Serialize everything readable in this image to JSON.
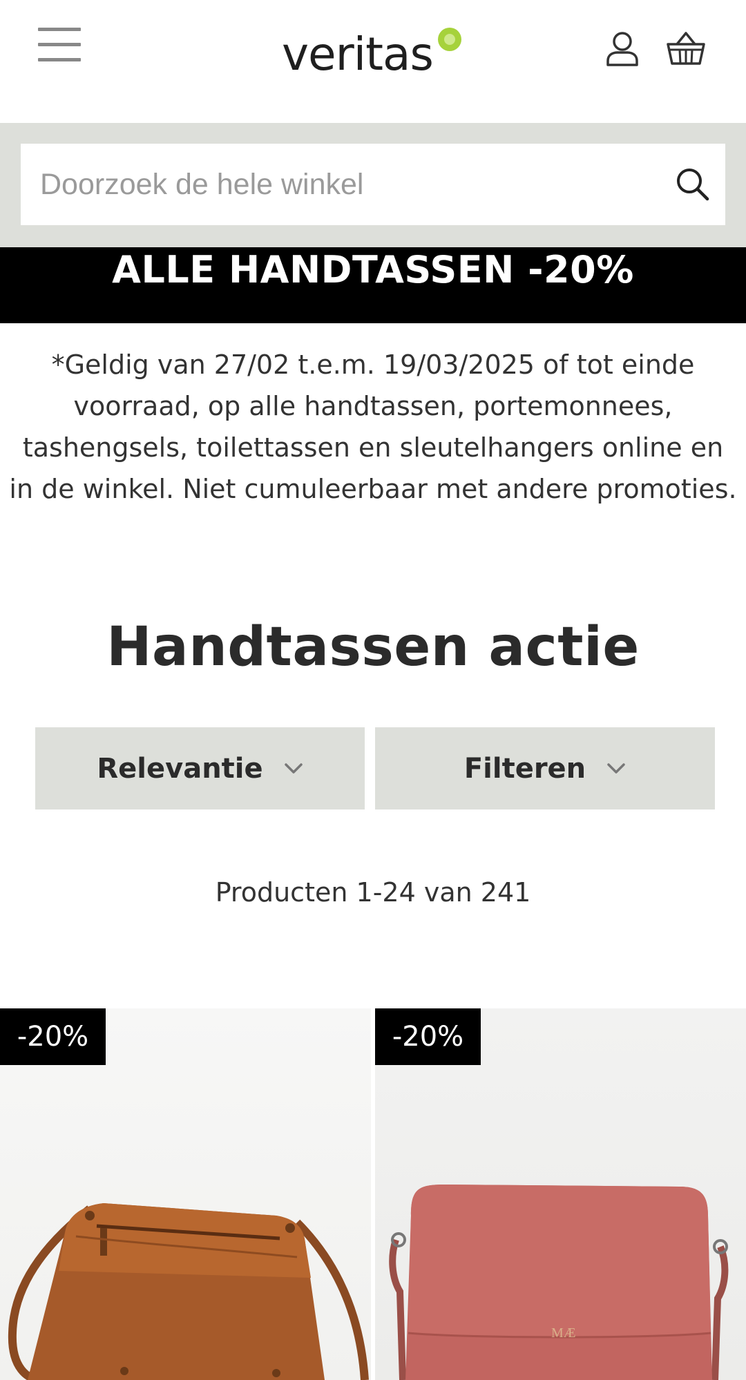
{
  "header": {
    "logo_text": "veritas",
    "menu_icon": "hamburger-menu-icon",
    "account_icon": "user-icon",
    "cart_icon": "basket-icon",
    "logo_dot_color": "#a6d23b"
  },
  "search": {
    "placeholder": "Doorzoek de hele winkel",
    "value": "",
    "icon": "search-icon"
  },
  "promo": {
    "banner_text": "ALLE HANDTASSEN -20%",
    "terms": "*Geldig van 27/02 t.e.m. 19/03/2025 of tot einde voorraad, op alle handtassen, portemonnees, tashengsels, toilettassen en sleutelhangers online en in de winkel. Niet cumuleerbaar met andere promoties."
  },
  "main": {
    "title": "Handtassen actie",
    "sort_label": "Relevantie",
    "filter_label": "Filteren",
    "product_count": "Producten 1-24 van 241"
  },
  "products": [
    {
      "badge": "-20%",
      "image": "brown leather crossbody bag"
    },
    {
      "badge": "-20%",
      "image": "pink suede crossbody bag",
      "brand_mark": "MAE"
    }
  ],
  "colors": {
    "accent_gray": "#dddfda",
    "banner_bg": "#000000",
    "brand_green": "#a6d23b"
  }
}
